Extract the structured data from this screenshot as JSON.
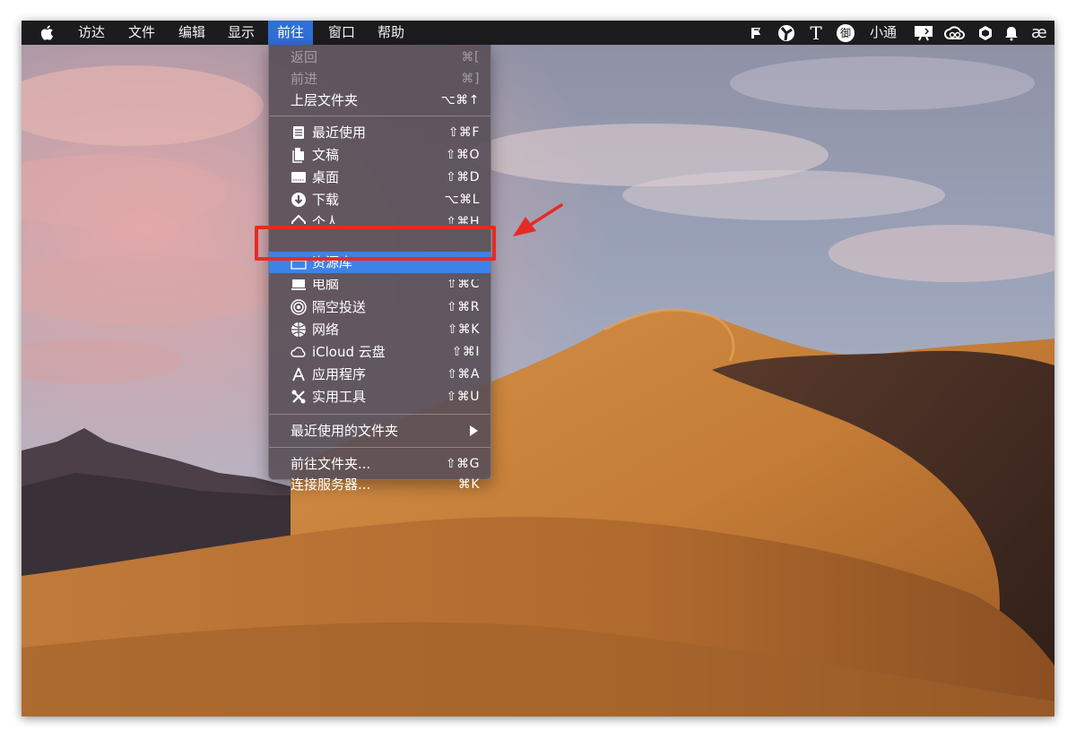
{
  "menubar": {
    "apple_icon": "apple-logo-icon",
    "items": [
      "访达",
      "文件",
      "编辑",
      "显示",
      "前往",
      "窗口",
      "帮助"
    ],
    "active_item": "前往",
    "status_items": {
      "user_name": "小通",
      "text_icon_glyph": "T",
      "ligature_glyph": "æ",
      "ime_glyph": "御"
    }
  },
  "go_menu": {
    "back": {
      "label": "返回",
      "shortcut": "⌘[",
      "enabled": false
    },
    "forward": {
      "label": "前进",
      "shortcut": "⌘]",
      "enabled": false
    },
    "enclosing": {
      "label": "上层文件夹",
      "shortcut": "⌥⌘↑"
    },
    "recents": {
      "label": "最近使用",
      "shortcut": "⇧⌘F",
      "icon": "recents-icon"
    },
    "documents": {
      "label": "文稿",
      "shortcut": "⇧⌘O",
      "icon": "documents-icon"
    },
    "desktop": {
      "label": "桌面",
      "shortcut": "⇧⌘D",
      "icon": "desktop-icon"
    },
    "downloads": {
      "label": "下载",
      "shortcut": "⌥⌘L",
      "icon": "download-icon"
    },
    "home": {
      "label": "个人",
      "shortcut": "⇧⌘H",
      "icon": "home-icon"
    },
    "library": {
      "label": "资源库",
      "shortcut": "",
      "icon": "folder-icon",
      "highlighted": true
    },
    "computer": {
      "label": "电脑",
      "shortcut": "⇧⌘C",
      "icon": "computer-icon"
    },
    "airdrop": {
      "label": "隔空投送",
      "shortcut": "⇧⌘R",
      "icon": "airdrop-icon"
    },
    "network": {
      "label": "网络",
      "shortcut": "⇧⌘K",
      "icon": "network-icon"
    },
    "icloud": {
      "label": "iCloud 云盘",
      "shortcut": "⇧⌘I",
      "icon": "cloud-icon"
    },
    "applications": {
      "label": "应用程序",
      "shortcut": "⇧⌘A",
      "icon": "applications-icon"
    },
    "utilities": {
      "label": "实用工具",
      "shortcut": "⇧⌘U",
      "icon": "utilities-icon"
    },
    "recent_folders": {
      "label": "最近使用的文件夹",
      "has_submenu": true
    },
    "go_to_folder": {
      "label": "前往文件夹...",
      "shortcut": "⇧⌘G"
    },
    "connect_server": {
      "label": "连接服务器...",
      "shortcut": "⌘K"
    }
  },
  "colors": {
    "menu_highlight": "#3d82e8",
    "menubar_active": "#2f6fd6",
    "annotation": "#e52b25"
  }
}
